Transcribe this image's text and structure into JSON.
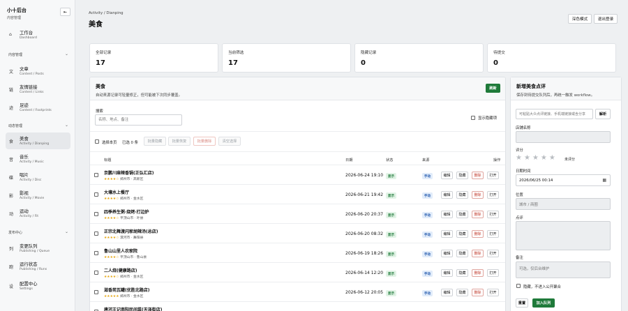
{
  "sidebar": {
    "brand_title": "小十后台",
    "brand_sub": "内容管理",
    "collapse_icon": "⇤",
    "home": {
      "label": "工作台",
      "sub": "Dashboard",
      "icon": "⌂"
    },
    "groups": [
      "内容管理",
      "动态管理",
      "发布中心"
    ],
    "content_items": [
      {
        "label": "文章",
        "sub": "Content / Posts",
        "icon": "文"
      },
      {
        "label": "友情链接",
        "sub": "Content / Links",
        "icon": "链"
      },
      {
        "label": "足迹",
        "sub": "Content / Footprints",
        "icon": "迹"
      }
    ],
    "activity_items": [
      {
        "label": "美食",
        "sub": "Activity / Dianping",
        "icon": "食"
      },
      {
        "label": "音乐",
        "sub": "Activity / Music",
        "icon": "音"
      },
      {
        "label": "唱片",
        "sub": "Activity / Disc",
        "icon": "碟"
      },
      {
        "label": "影视",
        "sub": "Activity / Movie",
        "icon": "影"
      },
      {
        "label": "运动",
        "sub": "Activity / Fit",
        "icon": "动"
      }
    ],
    "publish_items": [
      {
        "label": "变更队列",
        "sub": "Publishing / Queue",
        "icon": "列"
      },
      {
        "label": "运行状态",
        "sub": "Publishing / Runs",
        "icon": "跑"
      },
      {
        "label": "配置中心",
        "sub": "Settings",
        "icon": "设"
      }
    ]
  },
  "header": {
    "breadcrumb": "Activity / Dianping",
    "title": "美食",
    "dark_mode": "深色模式",
    "logout": "退出登录"
  },
  "stats": [
    {
      "label": "全部记录",
      "value": "17"
    },
    {
      "label": "当前筛选",
      "value": "17"
    },
    {
      "label": "隐藏记录",
      "value": "0"
    },
    {
      "label": "待提交",
      "value": "0"
    }
  ],
  "list_panel": {
    "title": "美食",
    "desc": "自动来源记录可轻量修正，但可能被下次同步覆盖。",
    "refresh": "刷新",
    "search_label": "搜索",
    "search_placeholder": "名称、地点、备注",
    "show_hidden": "显示隐藏项",
    "select_page": "选择本页",
    "selected": "已选 0 条",
    "bulk_hide": "批量隐藏",
    "bulk_restore": "批量恢复",
    "bulk_delete": "批量删除",
    "clear_selection": "清空选择",
    "columns": {
      "title": "标题",
      "date": "日期",
      "status": "状态",
      "source": "来源",
      "actions": "操作"
    },
    "action_labels": {
      "edit": "编辑",
      "hide": "隐藏",
      "delete": "删除",
      "open": "打开"
    },
    "rows": [
      {
        "title": "京鹏川麻辣香锅(正弘汇店)",
        "stars": "★★★★☆",
        "loc": "郑州市 · 高新区",
        "date": "2026-06-24 19:10",
        "status": "显示",
        "source": "手动"
      },
      {
        "title": "大壤水上餐厅",
        "stars": "★★★★☆",
        "loc": "郑州市 · 金水区",
        "date": "2026-06-21 19:42",
        "status": "显示",
        "source": "手动"
      },
      {
        "title": "四季养生粥·烧烤·打边炉",
        "stars": "★★★★☆",
        "loc": "平顶山市 · 叶县",
        "date": "2026-06-20 20:37",
        "status": "显示",
        "source": "手动"
      },
      {
        "title": "正宗北舞渡闪家胡辣汤(总店)",
        "stars": "★★★★☆",
        "loc": "漯河市 · 舞阳县",
        "date": "2026-06-20 08:32",
        "status": "显示",
        "source": "手动"
      },
      {
        "title": "鲁山山里人农家院",
        "stars": "★★★★☆",
        "loc": "平顶山市 · 鲁山县",
        "date": "2026-06-19 18:26",
        "status": "显示",
        "source": "手动"
      },
      {
        "title": "二人烧(健康路店)",
        "stars": "★★★★☆",
        "loc": "郑州市 · 金水区",
        "date": "2026-06-14 12:20",
        "status": "显示",
        "source": "手动"
      },
      {
        "title": "滋香苑瓦罐(优胜北路店)",
        "stars": "★★★★★",
        "loc": "郑州市 · 金水区",
        "date": "2026-06-12 20:05",
        "status": "显示",
        "source": "手动"
      },
      {
        "title": "唐河王记南阳民间菜(天泽街店)",
        "stars": "",
        "loc": "",
        "date": "",
        "status": "",
        "source": ""
      }
    ]
  },
  "form_panel": {
    "title": "新增美食点评",
    "desc": "保存到待提交队列后，再统一触发 workflow。",
    "link_placeholder": "可粘贴大众点评链接、手机端链接或含分享",
    "parse_button": "解析",
    "shop_name_label": "店铺名称",
    "rating_label": "评分",
    "unrated": "未评分",
    "datetime_label": "日期时间",
    "datetime_value": "2026/06/25  00:14",
    "location_label": "位置",
    "location_placeholder": "城市 / 商圈",
    "review_label": "点评",
    "note_label": "备注",
    "note_placeholder": "可选，仅后台维护",
    "hidden_label": "隐藏，不进入公开聚合",
    "reset_button": "重置",
    "add_button": "加入队列"
  }
}
